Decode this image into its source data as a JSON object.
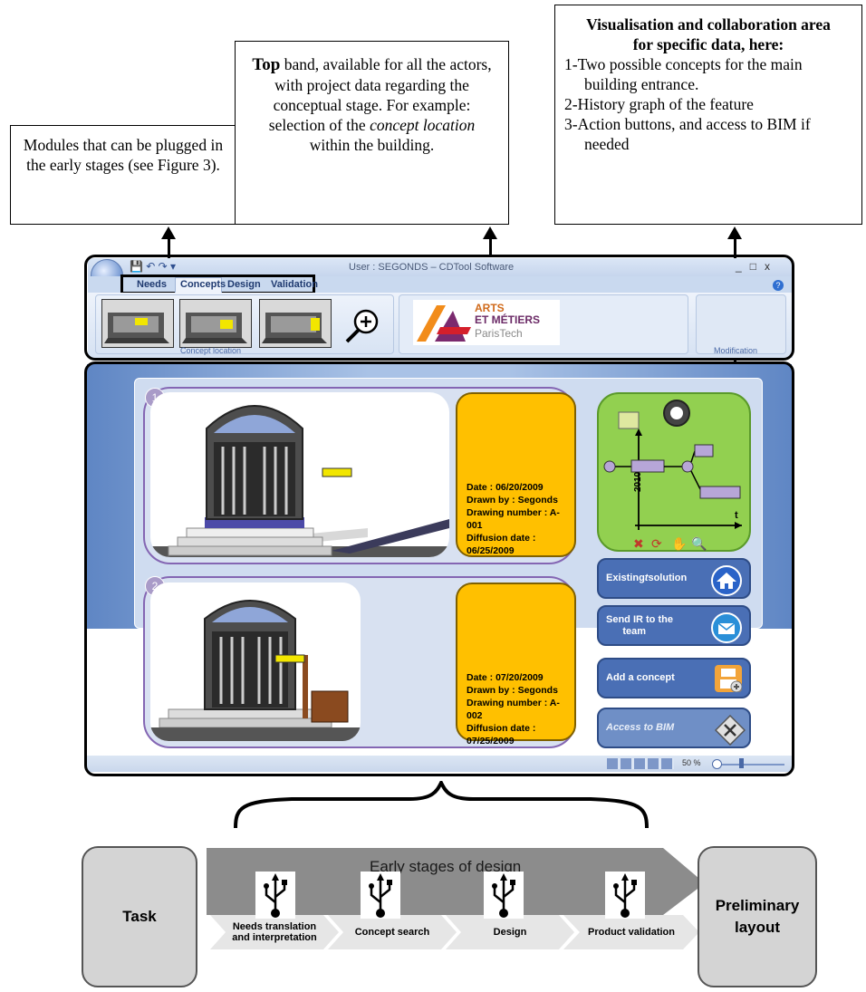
{
  "callouts": {
    "left": {
      "text": "Modules that can be plugged in the early stages (see Figure 3)."
    },
    "middle": {
      "lead": "Top",
      "text_a": " band, available for all the actors, with project data regarding the conceptual stage. For example: selection of the ",
      "em": "concept location",
      "text_b": " within the building."
    },
    "right": {
      "title": "Visualisation and collaboration area for specific data, here:",
      "items": [
        "1-Two possible concepts for the main building entrance.",
        "2-History graph of the feature",
        "3-Action buttons, and access to BIM if needed"
      ]
    }
  },
  "window": {
    "title": "User : SEGONDS – CDTool Software",
    "tabs": [
      "Needs",
      "Concepts",
      "Design",
      "Validation"
    ],
    "ribbon_group": "Concept location",
    "ribbon_right": "Modification",
    "logo_line1": "ARTS",
    "logo_line2": "ET MÉTIERS",
    "logo_line3": "ParisTech",
    "controls": [
      "_",
      "□",
      "x"
    ],
    "zoom": "50 %"
  },
  "concepts": [
    {
      "badge": "1",
      "info": "Date : 06/20/2009\nDrawn by : Segonds\nDrawing number : A-001\nDiffusion date :\n06/25/2009"
    },
    {
      "badge": "2",
      "info": "Date : 07/20/2009\nDrawn by : Segonds\nDrawing number : A-002\nDiffusion date :\n07/25/2009"
    }
  ],
  "history_graph": {
    "year": "2010",
    "axis": "t"
  },
  "actions": [
    {
      "pre": "Existing ",
      "em": "t",
      "post": " solution",
      "icon": "home-icon"
    },
    {
      "pre": "Send IR to the\n      team",
      "em": "",
      "post": "",
      "icon": "mail-icon"
    },
    {
      "pre": "Add a concept",
      "em": "",
      "post": "",
      "icon": "save-add-icon"
    },
    {
      "pre": "Access to BIM",
      "em": "",
      "post": "",
      "icon": "bim-icon"
    }
  ],
  "process": {
    "task": "Task",
    "banner": "Early stages of design",
    "stages": [
      "Needs translation and interpretation",
      "Concept search",
      "Design",
      "Product validation"
    ],
    "output": "Preliminary layout"
  }
}
